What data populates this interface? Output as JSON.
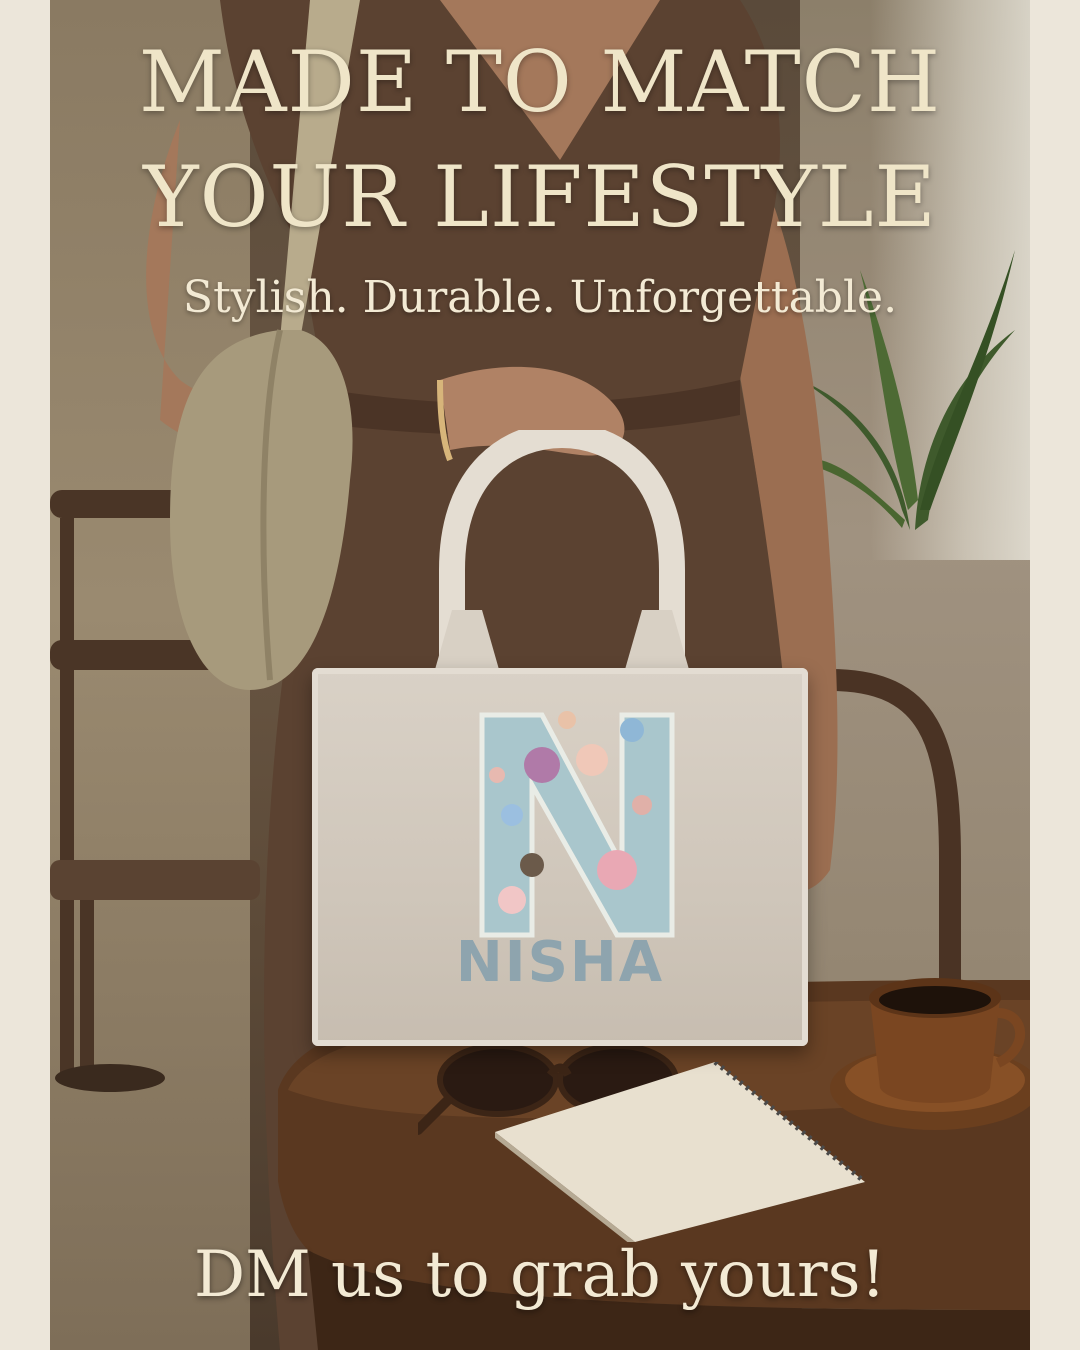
{
  "headline": {
    "line1": "MADE TO MATCH",
    "line2": "YOUR LIFESTYLE"
  },
  "tagline": "Stylish. Durable. Unforgettable.",
  "product": {
    "monogram_letter": "N",
    "name_text": "NISHA"
  },
  "cta": "DM us to grab yours!",
  "colors": {
    "headline_text": "#efe5c8",
    "bag": "#d3cabe",
    "name_text": "#8ea4ae",
    "dress": "#5b4231"
  },
  "icons": [
    "sunglasses",
    "coffee-cup",
    "notebook",
    "plant"
  ]
}
